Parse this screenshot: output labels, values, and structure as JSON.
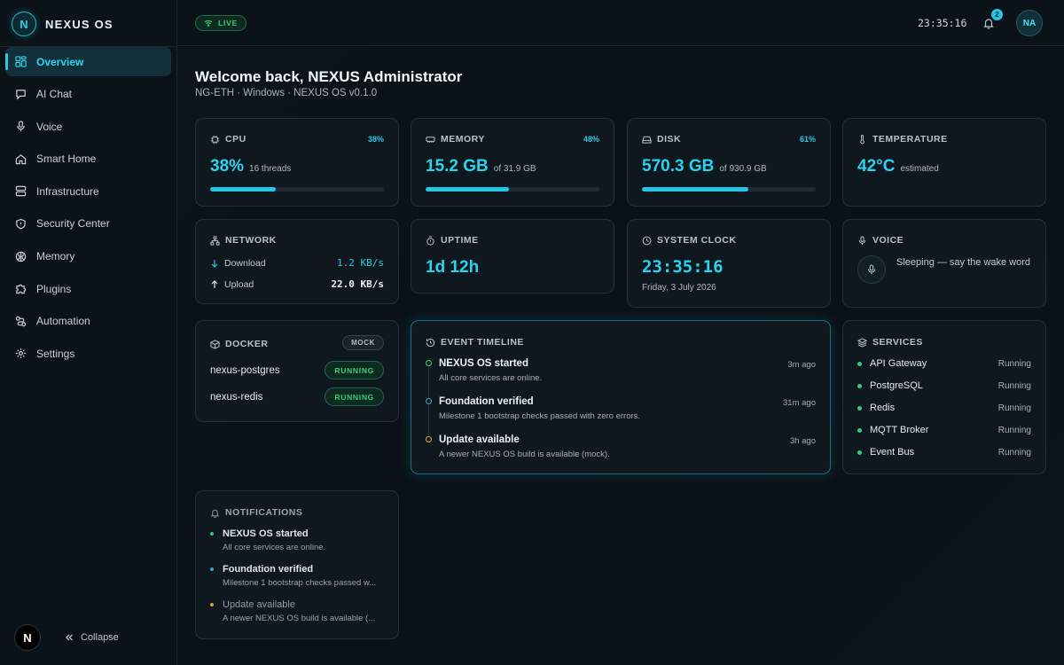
{
  "brand": {
    "logo_letter": "N",
    "name": "NEXUS OS"
  },
  "sidebar": {
    "items": [
      {
        "label": "Overview",
        "icon": "dashboard-icon",
        "active": true
      },
      {
        "label": "AI Chat",
        "icon": "chat-icon"
      },
      {
        "label": "Voice",
        "icon": "mic-icon"
      },
      {
        "label": "Smart Home",
        "icon": "home-icon"
      },
      {
        "label": "Infrastructure",
        "icon": "server-icon"
      },
      {
        "label": "Security Center",
        "icon": "shield-icon"
      },
      {
        "label": "Memory",
        "icon": "brain-icon"
      },
      {
        "label": "Plugins",
        "icon": "puzzle-icon"
      },
      {
        "label": "Automation",
        "icon": "workflow-icon"
      },
      {
        "label": "Settings",
        "icon": "gear-icon"
      }
    ],
    "footer_badge": "N",
    "collapse_label": "Collapse"
  },
  "topbar": {
    "live_label": "LIVE",
    "clock": "23:35:16",
    "notification_count": "2",
    "avatar_initials": "NA"
  },
  "header": {
    "title": "Welcome back, NEXUS Administrator",
    "subtitle": "NG-ETH · Windows · NEXUS OS v0.1.0"
  },
  "cpu": {
    "label": "CPU",
    "percent_label": "38%",
    "value": "38%",
    "sub": "16 threads",
    "fraction": 0.38
  },
  "memory": {
    "label": "MEMORY",
    "percent_label": "48%",
    "value": "15.2 GB",
    "sub": "of 31.9 GB",
    "fraction": 0.48
  },
  "disk": {
    "label": "DISK",
    "percent_label": "61%",
    "value": "570.3 GB",
    "sub": "of 930.9 GB",
    "fraction": 0.61
  },
  "temperature": {
    "label": "TEMPERATURE",
    "value": "42°C",
    "sub": "estimated"
  },
  "network": {
    "label": "NETWORK",
    "download_label": "Download",
    "download_value": "1.2 KB/s",
    "upload_label": "Upload",
    "upload_value": "22.0 KB/s"
  },
  "uptime": {
    "label": "UPTIME",
    "value": "1d 12h"
  },
  "system_clock": {
    "label": "SYSTEM CLOCK",
    "time": "23:35:16",
    "date": "Friday, 3 July 2026"
  },
  "voice": {
    "label": "VOICE",
    "status": "Sleeping — say the wake word"
  },
  "docker": {
    "label": "DOCKER",
    "badge": "MOCK",
    "containers": [
      {
        "name": "nexus-postgres",
        "status": "RUNNING"
      },
      {
        "name": "nexus-redis",
        "status": "RUNNING"
      }
    ]
  },
  "timeline": {
    "label": "EVENT TIMELINE",
    "events": [
      {
        "title": "NEXUS OS started",
        "desc": "All core services are online.",
        "time": "3m ago",
        "color": "#2fce7a"
      },
      {
        "title": "Foundation verified",
        "desc": "Milestone 1 bootstrap checks passed with zero errors.",
        "time": "31m ago",
        "color": "#2aa9d8"
      },
      {
        "title": "Update available",
        "desc": "A newer NEXUS OS build is available (mock).",
        "time": "3h ago",
        "color": "#e0a030"
      }
    ]
  },
  "services": {
    "label": "SERVICES",
    "items": [
      {
        "name": "API Gateway",
        "status": "Running"
      },
      {
        "name": "PostgreSQL",
        "status": "Running"
      },
      {
        "name": "Redis",
        "status": "Running"
      },
      {
        "name": "MQTT Broker",
        "status": "Running"
      },
      {
        "name": "Event Bus",
        "status": "Running"
      }
    ]
  },
  "notifications": {
    "label": "NOTIFICATIONS",
    "items": [
      {
        "title": "NEXUS OS started",
        "desc": "All core services are online.",
        "color": "#2fce7a"
      },
      {
        "title": "Foundation verified",
        "desc": "Milestone 1 bootstrap checks passed w...",
        "color": "#2aa9d8"
      },
      {
        "title": "Update available",
        "desc": "A newer NEXUS OS build is available (...",
        "color": "#e0a030"
      }
    ]
  }
}
